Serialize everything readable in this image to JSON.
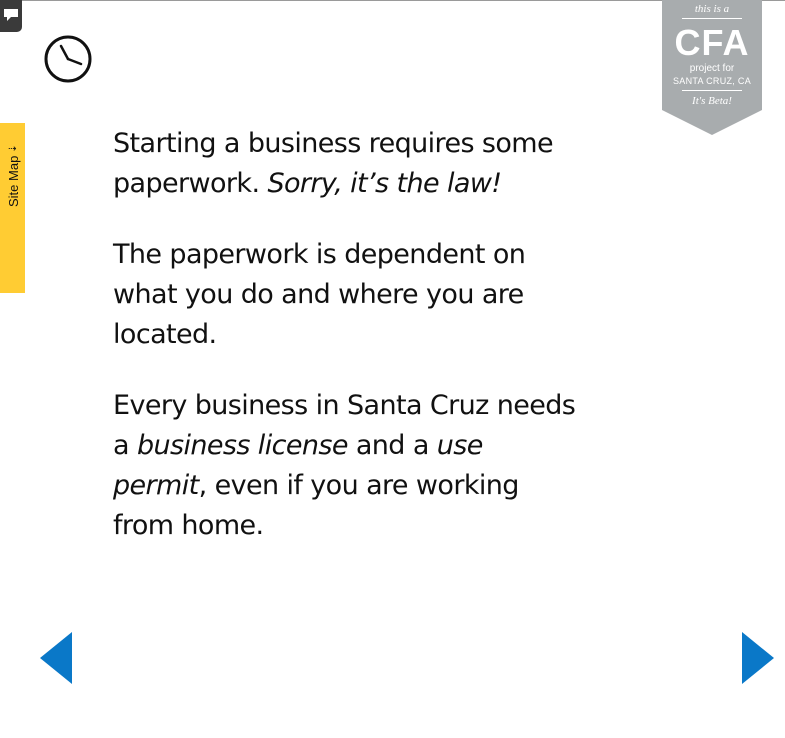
{
  "sidebar": {
    "site_map_label": "Site Map"
  },
  "badge": {
    "top_line": "this is a",
    "title": "CFA",
    "line1": "project for",
    "line2": "SANTA CRUZ, CA",
    "bottom_line": "It's Beta!"
  },
  "content": {
    "p1_a": "Starting a business requires some paperwork. ",
    "p1_em": "Sorry, it’s the law!",
    "p2": "The paperwork is dependent on what you do and where you are located.",
    "p3_a": "Every business in Santa Cruz needs a ",
    "p3_em1": "business license",
    "p3_b": " and a ",
    "p3_em2": "use permit",
    "p3_c": ", even if you are working from home."
  },
  "colors": {
    "site_map_tab": "#ffcc33",
    "badge_gray": "#a8acae",
    "nav_arrow": "#0a78c8",
    "feedback_tab": "#3a3a3a"
  },
  "icons": {
    "feedback": "speech-bubble-icon",
    "clock": "clock-icon",
    "prev": "triangle-left-icon",
    "next": "triangle-right-icon"
  }
}
